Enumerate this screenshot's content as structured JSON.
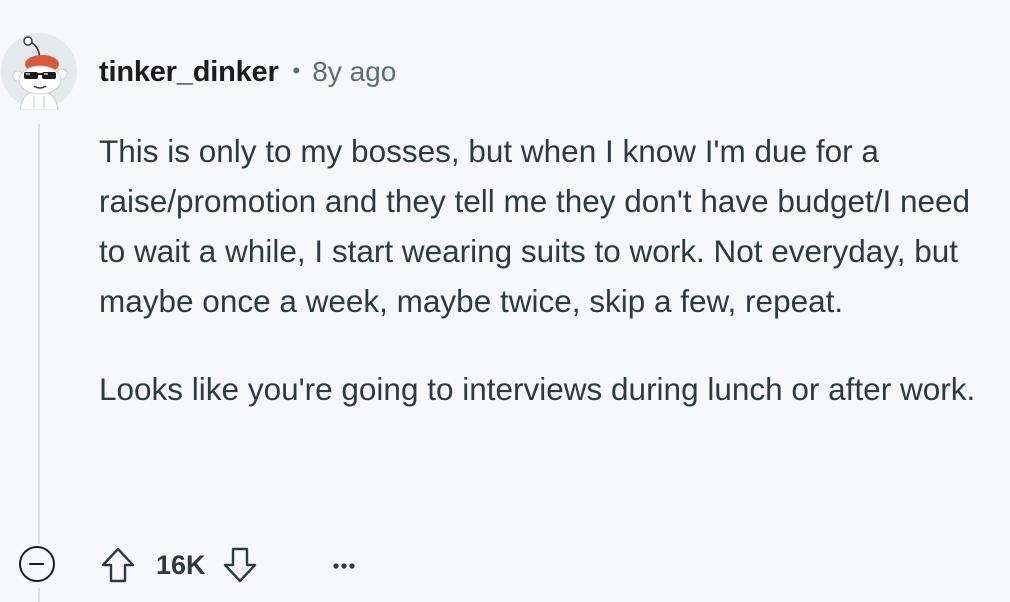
{
  "comment": {
    "username": "tinker_dinker",
    "separator": "•",
    "timestamp": "8y ago",
    "avatar_icon": "snoo-sunglasses-avatar",
    "paragraphs": [
      "This is only to my bosses, but when I know I'm due for a raise/promotion and they tell me they don't have budget/I need to wait a while, I start wearing suits to work. Not everyday, but maybe once a week, maybe twice, skip a few, repeat.",
      "Looks like you're going to interviews during lunch or after work."
    ]
  },
  "actions": {
    "collapse_icon": "collapse-minus-icon",
    "upvote_icon": "upvote-arrow-icon",
    "score": "16K",
    "downvote_icon": "downvote-arrow-icon",
    "more_icon": "ellipsis-icon"
  },
  "colors": {
    "background": "#f7f8fa",
    "text": "#2a3c42",
    "username": "#1c1c1c",
    "meta": "#576f76",
    "thread_line": "#d8e0e3"
  }
}
